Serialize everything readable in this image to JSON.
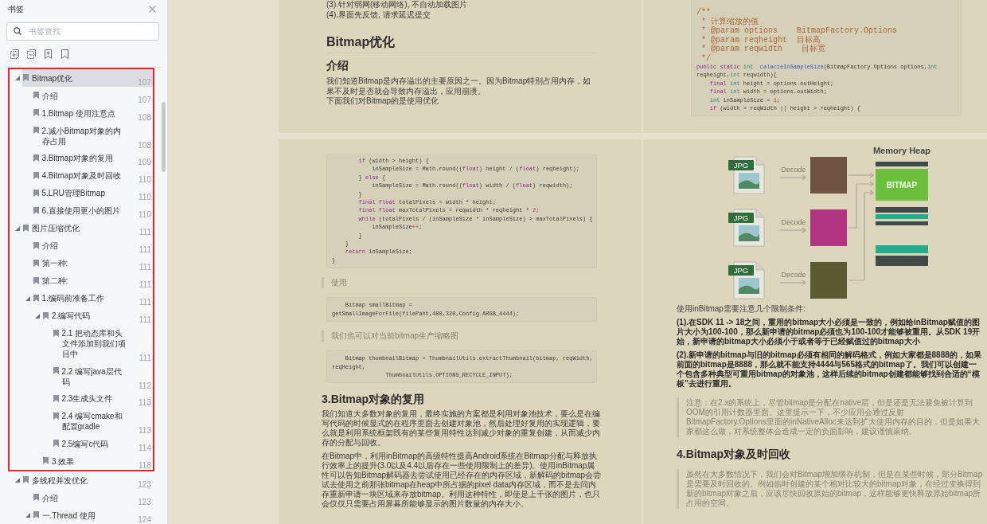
{
  "sidebar": {
    "title": "书签",
    "search": {
      "placeholder": "书签查找"
    },
    "tree": [
      {
        "label": "Bitmap优化",
        "page": "107",
        "selected": true,
        "expanded": true,
        "framed": true,
        "children": [
          {
            "label": "介绍",
            "page": "107",
            "selected": false
          },
          {
            "label": "1.Bitmap 使用注意点",
            "page": "108",
            "selected": false
          },
          {
            "label": "2.减小Bitmap对象的内存占用",
            "page": "108",
            "selected": false
          },
          {
            "label": "3.Bitmap对象的复用",
            "page": "109",
            "selected": false
          },
          {
            "label": "4.Bitmap对象及时回收",
            "page": "110",
            "selected": false
          },
          {
            "label": "5.LRU管理Bitmap",
            "page": "110",
            "selected": false
          },
          {
            "label": "6.直接使用更小的图片",
            "page": "110",
            "selected": false
          }
        ]
      },
      {
        "label": "图片压缩优化",
        "page": "111",
        "selected": false,
        "expanded": true,
        "framed": true,
        "children": [
          {
            "label": "介绍",
            "page": "111",
            "selected": false
          },
          {
            "label": "第一种:",
            "page": "111",
            "selected": false
          },
          {
            "label": "第二种:",
            "page": "111",
            "selected": false
          },
          {
            "label": "1.编码前准备工作",
            "page": "111",
            "selected": false,
            "expanded": true,
            "children": [
              {
                "label": "2.编写代码",
                "page": "111",
                "selected": false,
                "expanded": true,
                "children": [
                  {
                    "label": "2.1 把动态库和头文件添加到我们项目中",
                    "page": "111",
                    "selected": false
                  },
                  {
                    "label": "2.2 编写java层代码",
                    "page": "112",
                    "selected": false
                  },
                  {
                    "label": "2.3生成头文件",
                    "page": "113",
                    "selected": false
                  },
                  {
                    "label": "2.4 编写cmake和配置gradle",
                    "page": "113",
                    "selected": false
                  },
                  {
                    "label": "2.5编写c代码",
                    "page": "114",
                    "selected": false
                  }
                ]
              },
              {
                "label": "3.效果",
                "page": "118",
                "selected": false
              }
            ]
          }
        ]
      },
      {
        "label": "多线程并发优化",
        "page": "123",
        "selected": false,
        "expanded": true,
        "framed": false,
        "children": [
          {
            "label": "介绍",
            "page": "123",
            "selected": false
          },
          {
            "label": "一.Thread 使用",
            "page": "124",
            "selected": false,
            "expanded": true
          }
        ]
      }
    ]
  },
  "pages": [
    {
      "left": [
        {
          "kind": "line",
          "text": "(3).针对弱网(移动网络), 不自动加载图片"
        },
        {
          "kind": "line",
          "text": "(4).界面先反馈, 请求延迟提交"
        },
        {
          "kind": "h1",
          "text": "Bitmap优化"
        },
        {
          "kind": "h3",
          "text": "介绍"
        },
        {
          "kind": "line",
          "text": "我们知道Bitmap是内存溢出的主要原因之一。因为Bitmap特别占用内存，如果不及时是否就会导致内存溢出，应用崩溃。"
        },
        {
          "kind": "line",
          "text": "下面我们对Bitmap的是使用优化"
        }
      ],
      "right": [
        {
          "kind": "code",
          "lines": [
            [
              {
                "kind": "comment",
                "text": "/**"
              }
            ],
            [
              {
                "kind": "comment",
                "text": " * 计算缩放的值"
              }
            ],
            [
              {
                "kind": "comment",
                "text": " * @param options    BitmapFactory.Options"
              }
            ],
            [
              {
                "kind": "comment",
                "text": " * @param reqheight  目标高"
              }
            ],
            [
              {
                "kind": "comment",
                "text": " * @param reqwidth    目标宽"
              }
            ],
            [
              {
                "kind": "comment",
                "text": " */"
              }
            ],
            [
              {
                "kind": "kw",
                "text": "public static "
              },
              {
                "kind": "type",
                "text": "int"
              },
              {
                "kind": "fn",
                "text": "  calacteInSampleSize"
              },
              {
                "kind": "plain",
                "text": "(BitmapFactory.Options options,"
              },
              {
                "kind": "type",
                "text": "int"
              }
            ],
            [
              {
                "kind": "plain",
                "text": "reqheight,"
              },
              {
                "kind": "type",
                "text": "int"
              },
              {
                "kind": "plain",
                "text": " reqwidth){"
              }
            ],
            [
              {
                "kind": "kw",
                "text": "    final "
              },
              {
                "kind": "type",
                "text": "int"
              },
              {
                "kind": "plain",
                "text": " height = options.outHeight;"
              }
            ],
            [
              {
                "kind": "kw",
                "text": "    final "
              },
              {
                "kind": "type",
                "text": "int"
              },
              {
                "kind": "plain",
                "text": " width = options.outWidth;"
              }
            ],
            [
              {
                "kind": "type",
                "text": "    int"
              },
              {
                "kind": "plain",
                "text": " inSampleSize = "
              },
              {
                "kind": "num",
                "text": "1"
              },
              {
                "kind": "plain",
                "text": ";"
              }
            ],
            [
              {
                "kind": "kw",
                "text": "    if"
              },
              {
                "kind": "plain",
                "text": " (width > reqWidth || height > reqheight) {"
              }
            ]
          ]
        }
      ]
    },
    {
      "left": [
        {
          "kind": "code",
          "lines": [
            [
              {
                "kind": "kw",
                "text": "        if"
              },
              {
                "kind": "plain",
                "text": " (width > height) {"
              }
            ],
            [
              {
                "kind": "plain",
                "text": "            inSampleSize = Math.round(("
              },
              {
                "kind": "kw",
                "text": "float"
              },
              {
                "kind": "plain",
                "text": ") height / ("
              },
              {
                "kind": "kw",
                "text": "float"
              },
              {
                "kind": "plain",
                "text": ") reqheight);"
              }
            ],
            [
              {
                "kind": "plain",
                "text": "        } "
              },
              {
                "kind": "kw",
                "text": "else"
              },
              {
                "kind": "plain",
                "text": " {"
              }
            ],
            [
              {
                "kind": "plain",
                "text": "            inSampleSize = Math.round(("
              },
              {
                "kind": "kw",
                "text": "float"
              },
              {
                "kind": "plain",
                "text": ") width / ("
              },
              {
                "kind": "kw",
                "text": "float"
              },
              {
                "kind": "plain",
                "text": ") reqwidth);"
              }
            ],
            [
              {
                "kind": "plain",
                "text": "        }"
              }
            ],
            [
              {
                "kind": "kw",
                "text": "        final float"
              },
              {
                "kind": "plain",
                "text": " totalPixels = width * height;"
              }
            ],
            [
              {
                "kind": "kw",
                "text": "        final float"
              },
              {
                "kind": "plain",
                "text": " maxTotalPixels = reqwidth * reqheight * "
              },
              {
                "kind": "num",
                "text": "2"
              },
              {
                "kind": "plain",
                "text": ";"
              }
            ],
            [
              {
                "kind": "kw",
                "text": "        while"
              },
              {
                "kind": "plain",
                "text": " (totalPixels / (inSampleSize * inSampleSize) > maxTotalPixels) {"
              }
            ],
            [
              {
                "kind": "plain",
                "text": "            inSampleSize"
              },
              {
                "kind": "num",
                "text": "++"
              },
              {
                "kind": "plain",
                "text": ";"
              }
            ],
            [
              {
                "kind": "plain",
                "text": "        }"
              }
            ],
            [
              {
                "kind": "plain",
                "text": "    }"
              }
            ],
            [
              {
                "kind": "kw",
                "text": "    return"
              },
              {
                "kind": "plain",
                "text": " inSampleSize;"
              }
            ],
            [
              {
                "kind": "plain",
                "text": "}"
              }
            ]
          ]
        },
        {
          "kind": "quote",
          "text": "使用"
        },
        {
          "kind": "code",
          "lines": [
            [
              {
                "kind": "plain",
                "text": "    Bitmap smallBitmap ="
              }
            ],
            [
              {
                "kind": "plain",
                "text": "getSmallImageForFile(filePaht,480,320,Config.ARGB_4444);"
              }
            ]
          ]
        },
        {
          "kind": "quote",
          "text": "我们也可以对当前bitmap生产缩略图"
        },
        {
          "kind": "code",
          "lines": [
            [
              {
                "kind": "plain",
                "text": "    Bitmap thumbnailBitmap = ThumbnailUtils.extractThumbnail(bitmap, reqWidth,"
              }
            ],
            [
              {
                "kind": "plain",
                "text": "reqHeight,"
              }
            ],
            [
              {
                "kind": "plain",
                "text": "                ThumbnailUtils.OPTIONS_RECYCLE_INPUT);"
              }
            ]
          ]
        },
        {
          "kind": "h2",
          "text": "3.Bitmap对象的复用"
        },
        {
          "kind": "para",
          "text": "我们知道大多数对象的复用，最终实施的方案都是利用对象池技术，要么是在编写代码的时候显式的在程序里面去创建对象池，然后处理好复用的实现逻辑，要么就是利用系统框架既有的某些复用特性达到减少对象的重复创建，从而减少内存的分配与回收。"
        },
        {
          "kind": "para",
          "text": "在Bitmap中，利用inBitmap的高级特性提高Android系统在Bitmap分配与释放执行效率上的提升(3.0以及4.4以后存在一些使用限制上的差异)。使用inBitmap属性可以告知Bitmap解码器去尝试使用已经存在的内存区域，新解码的bitmap会尝试去使用之前那张bitmap在heap中所占据的pixel data内存区域，而不是去问内存重新申请一块区域来存放bitmap。利用这种特性，即使是上千张的图片，也只会仅仅只需要占用屏幕所能够显示的图片数量的内存大小。"
        }
      ],
      "right": [
        {
          "kind": "figure",
          "title": "Memory Heap",
          "block_label": "BITMAP",
          "sources": [
            {
              "badge": "JPG",
              "action": "Decode"
            },
            {
              "badge": "JPG",
              "action": "Decode"
            },
            {
              "badge": "JPG",
              "action": "Decode"
            }
          ]
        },
        {
          "kind": "para",
          "text": "使用inBitmap需要注意几个限制条件:"
        },
        {
          "kind": "strong",
          "text": "(1).在SDK 11 -> 18之间，重用的bitmap大小必须是一致的，例如给inBitmap赋值的图片大小为100-100，那么新申请的bitmap必须也为100-100才能够被重用。从SDK 19开始，新申请的bitmap大小必须小于或者等于已经赋值过的bitmap大小"
        },
        {
          "kind": "strong",
          "text": "(2).新申请的bitmap与旧的bitmap必须有相同的解码格式，例如大家都是8888的，如果前面的bitmap是8888，那么就不能支持4444与565格式的bitmap了。我们可以创建一个包含多种典型可重用bitmap的对象池，这样后续的bitmap创建都能够找到合适的“模板”去进行重用。"
        },
        {
          "kind": "quote",
          "text": "注意：在2.x的系统上，尽管bitmap是分配在native层，但是还是无法避免被计算到OOM的引用计数器里面。这里提示一下，不少应用会通过反射BitmapFactory.Options里面的inNativeAlloc来达到扩大使用内存的目的，但是如果大家都这么做，对系统整体会造成一定的负面影响，建议谨慎采纳。"
        },
        {
          "kind": "h2",
          "text": "4.Bitmap对象及时回收"
        },
        {
          "kind": "quote",
          "text": "虽然在大多数情况下，我们会对Bitmap增加缓存机制，但是在某些时候，部分Bitmap是需要及时回收的。例如临时创建的某个相对比较大的bitmap对象，在经过变换得到新的bitmap对象之后，应该尽快回收原始的bitmap，这样能够更快释放原始bitmap所占用的空间。"
        }
      ]
    }
  ]
}
